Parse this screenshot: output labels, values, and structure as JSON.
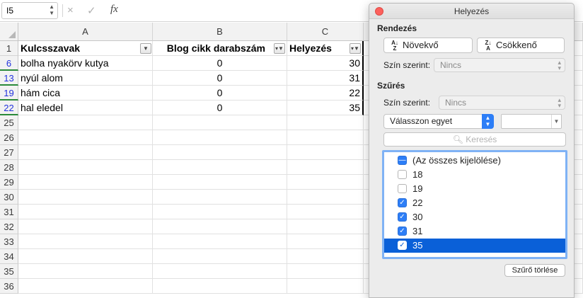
{
  "formula_bar": {
    "name_box": "I5",
    "cancel_icon": "×",
    "confirm_icon": "✓",
    "fx_label": "fx",
    "formula": ""
  },
  "sheet": {
    "columns": [
      "A",
      "B",
      "C"
    ],
    "header_row": {
      "row_number": "1",
      "cells": [
        "Kulcsszavak",
        "Blog cikk darabszám",
        "Helyezés"
      ]
    },
    "data_rows": [
      {
        "row_number": "6",
        "keyword": "bolha nyakörv kutya",
        "count": "0",
        "position": "30"
      },
      {
        "row_number": "13",
        "keyword": "nyúl alom",
        "count": "0",
        "position": "31"
      },
      {
        "row_number": "19",
        "keyword": "hám cica",
        "count": "0",
        "position": "22"
      },
      {
        "row_number": "22",
        "keyword": "hal eledel",
        "count": "0",
        "position": "35"
      }
    ],
    "empty_rows": [
      "25",
      "26",
      "27",
      "28",
      "29",
      "30",
      "31",
      "32",
      "33",
      "34",
      "35",
      "36"
    ],
    "filtered_row_color": "#2233dd"
  },
  "filter_panel": {
    "title": "Helyezés",
    "sort_section": "Rendezés",
    "sort_ascending": "Növekvő",
    "sort_descending": "Csökkenő",
    "sort_color_label": "Szín szerint:",
    "sort_color_value": "Nincs",
    "filter_section": "Szűrés",
    "filter_color_label": "Szín szerint:",
    "filter_color_value": "Nincs",
    "choose_one": "Válasszon egyet",
    "search_placeholder": "Keresés",
    "items": [
      {
        "label": "(Az összes kijelölése)",
        "state": "mixed"
      },
      {
        "label": "18",
        "state": "off"
      },
      {
        "label": "19",
        "state": "off"
      },
      {
        "label": "22",
        "state": "on"
      },
      {
        "label": "30",
        "state": "on"
      },
      {
        "label": "31",
        "state": "on"
      },
      {
        "label": "35",
        "state": "on",
        "selected": true
      }
    ],
    "clear_filter": "Szűrő törlése",
    "accent_color": "#2d7ef7"
  }
}
